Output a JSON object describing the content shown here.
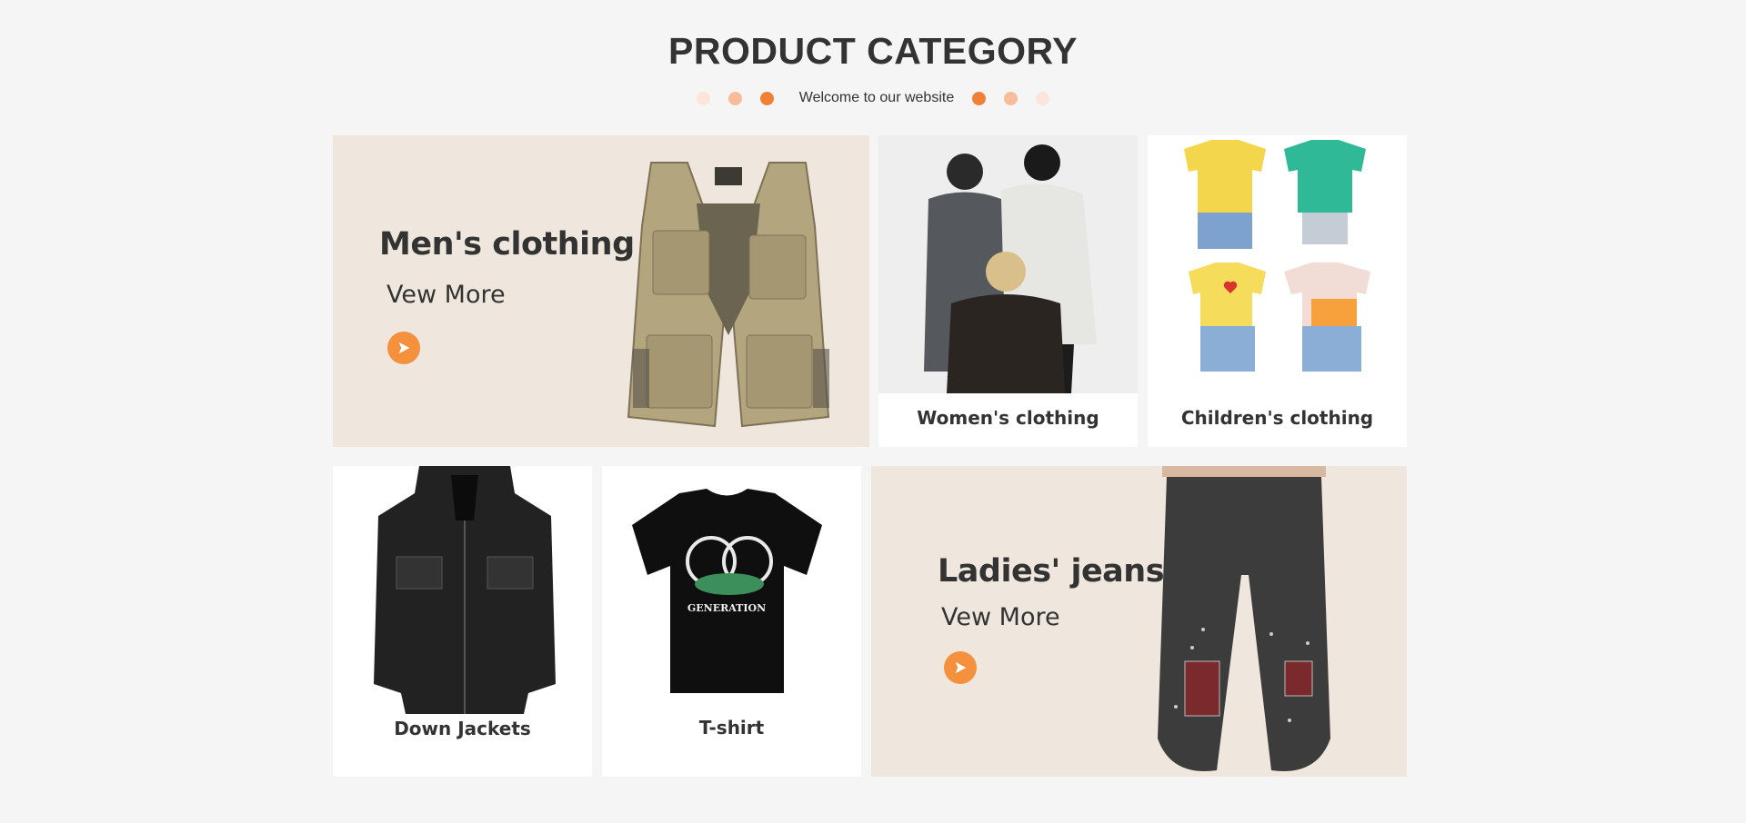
{
  "header": {
    "title": "PRODUCT CATEGORY",
    "subtitle": "Welcome to our website",
    "dot_colors": [
      "#fde5db",
      "#f8bc9c",
      "#f08037"
    ]
  },
  "promos": {
    "mens": {
      "title": "Men's clothing",
      "more_label": "Vew More",
      "image_icon": "vest-image"
    },
    "ladies_jeans": {
      "title": "Ladies' jeans",
      "more_label": "Vew More",
      "image_icon": "jeans-image"
    }
  },
  "cards": {
    "womens": {
      "caption": "Women's clothing"
    },
    "childrens": {
      "caption": "Children's clothing"
    },
    "down_jackets": {
      "caption": "Down Jackets"
    },
    "tshirt": {
      "caption": "T-shirt",
      "print_text": "GENERATION"
    }
  },
  "colors": {
    "accent": "#f5903d",
    "beige_panel": "#efe7dd",
    "page_bg": "#f5f5f5"
  }
}
